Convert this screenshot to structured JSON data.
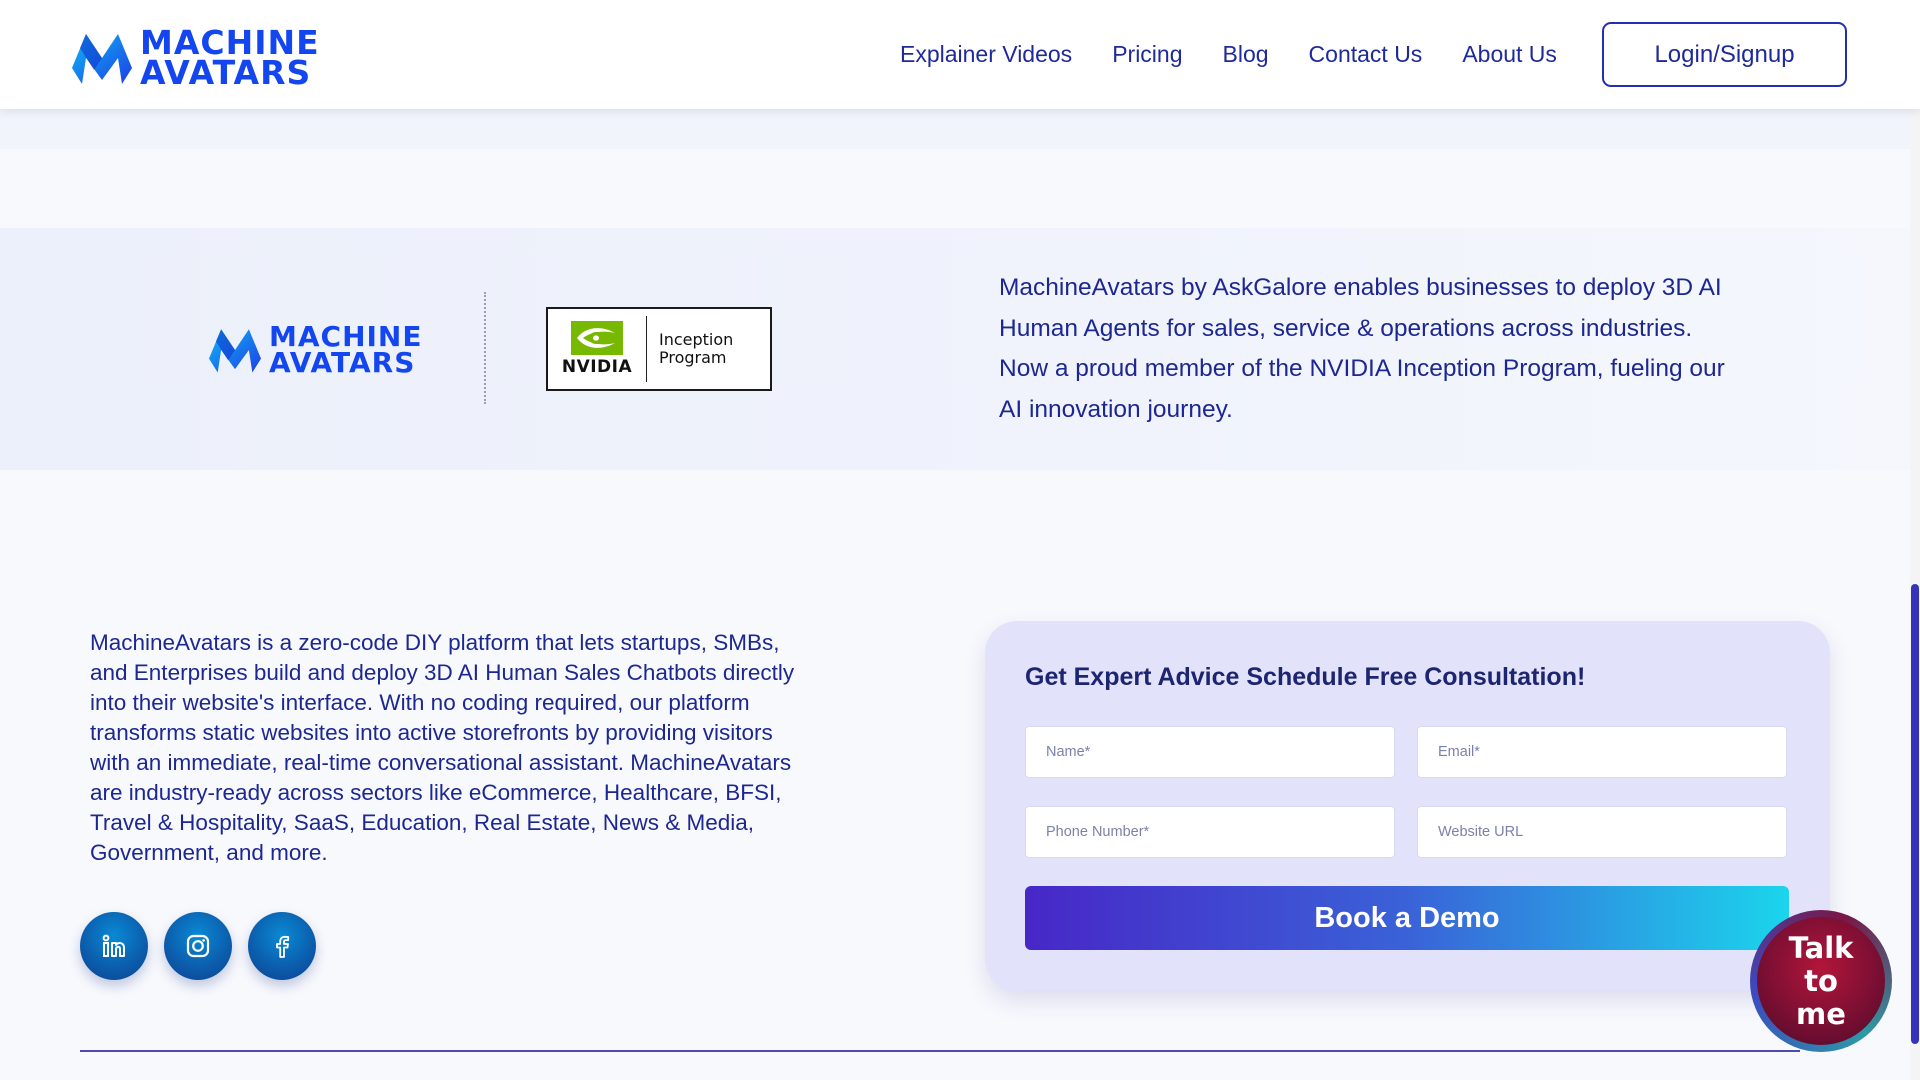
{
  "header": {
    "brand": {
      "line1": "MACHINE",
      "line2": "AVATARS"
    },
    "nav": [
      {
        "label": "Explainer Videos"
      },
      {
        "label": "Pricing"
      },
      {
        "label": "Blog"
      },
      {
        "label": "Contact Us"
      },
      {
        "label": "About Us"
      }
    ],
    "login_label": "Login/Signup"
  },
  "partner": {
    "brand": {
      "line1": "MACHINE",
      "line2": "AVATARS"
    },
    "nvidia_word": "NVIDIA",
    "nvidia_program_line1": "Inception",
    "nvidia_program_line2": "Program",
    "description": "MachineAvatars by AskGalore enables businesses to deploy 3D AI Human Agents for sales, service & operations across industries. Now a proud member of the NVIDIA Inception Program, fueling our AI innovation journey."
  },
  "about": {
    "description": "MachineAvatars is a zero-code DIY platform that lets startups, SMBs, and Enterprises build and deploy 3D AI Human Sales Chatbots directly into their website's interface. With no coding required, our platform transforms static websites into active storefronts by providing visitors with an immediate, real-time conversational assistant. MachineAvatars are industry-ready across sectors like eCommerce, Healthcare, BFSI, Travel & Hospitality, SaaS, Education, Real Estate, News & Media, Government, and more.",
    "socials": [
      {
        "icon": "linkedin-icon"
      },
      {
        "icon": "instagram-icon"
      },
      {
        "icon": "facebook-icon"
      }
    ]
  },
  "form": {
    "title": "Get Expert Advice Schedule Free Consultation!",
    "name_placeholder": "Name*",
    "email_placeholder": "Email*",
    "phone_placeholder": "Phone Number*",
    "url_placeholder": "Website URL",
    "submit_label": "Book a Demo"
  },
  "widget": {
    "label": "Talk\nto\nme"
  },
  "colors": {
    "brand_blue": "#1446ef",
    "nav_text": "#1f2a9a",
    "nvidia_green": "#76b900",
    "button_gradient_start": "#4727c7",
    "button_gradient_end": "#1bd5ec",
    "widget_red": "#9a1238"
  }
}
